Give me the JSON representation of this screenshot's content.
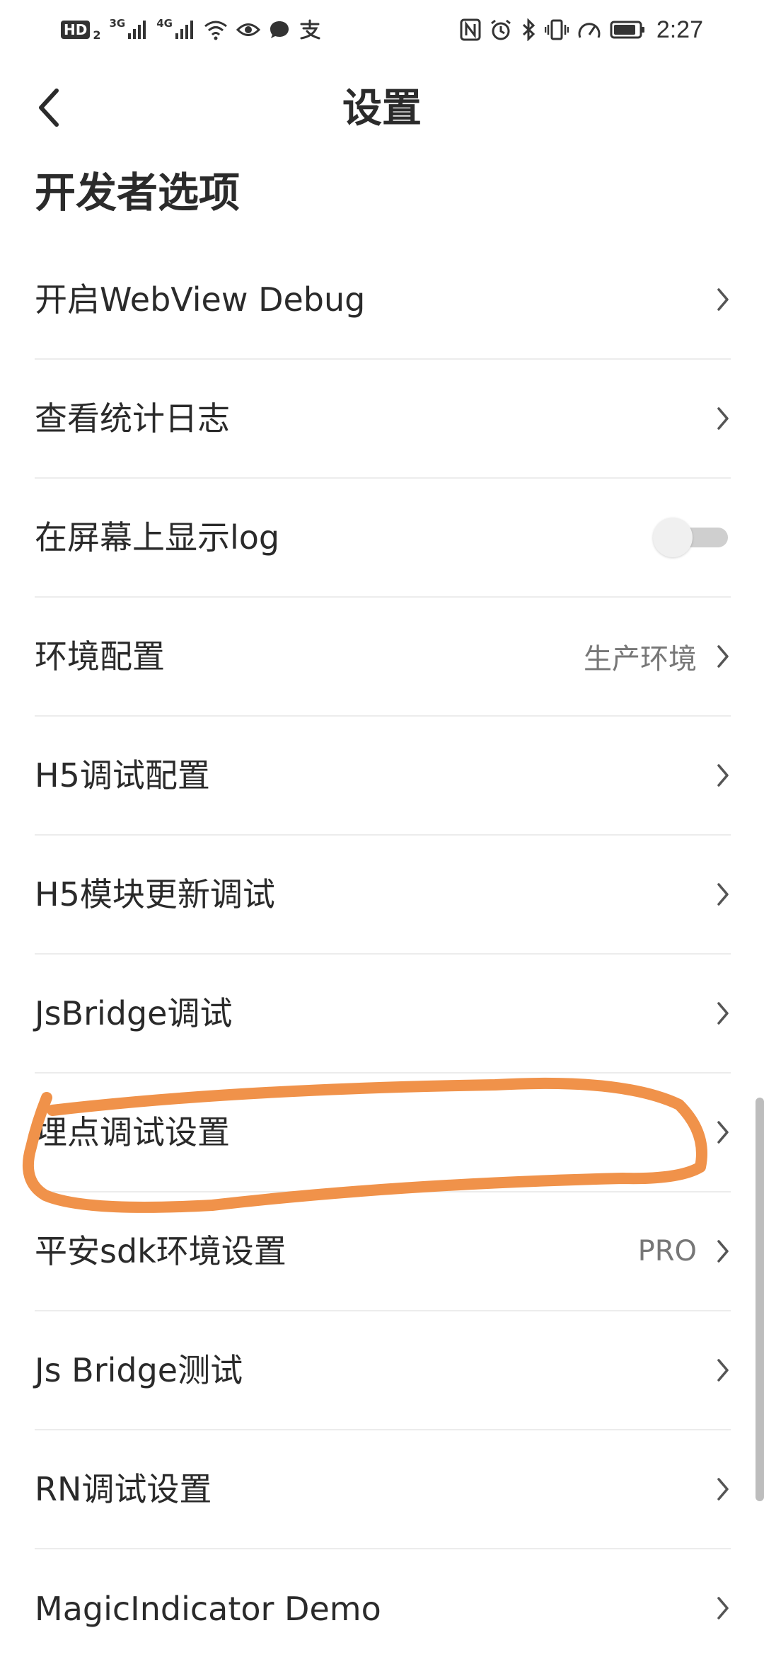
{
  "status_bar": {
    "hd_badge": "HD",
    "sim_index": "2",
    "net_3g": "3G",
    "net_4g": "4G",
    "time": "2:27",
    "icons": [
      "signal-icon",
      "wifi-icon",
      "eye-icon",
      "message-icon",
      "alipay-icon",
      "nfc-icon",
      "alarm-icon",
      "bluetooth-icon",
      "vibrate-icon",
      "speed-icon",
      "battery-icon"
    ]
  },
  "nav": {
    "back_icon": "chevron-left-icon",
    "title": "设置"
  },
  "section": {
    "title": "开发者选项"
  },
  "settings": [
    {
      "label": "开启WebView Debug",
      "value": "",
      "control": "chevron"
    },
    {
      "label": "查看统计日志",
      "value": "",
      "control": "chevron"
    },
    {
      "label": "在屏幕上显示log",
      "value": "",
      "control": "toggle",
      "toggle_on": false
    },
    {
      "label": "环境配置",
      "value": "生产环境",
      "control": "chevron"
    },
    {
      "label": "H5调试配置",
      "value": "",
      "control": "chevron"
    },
    {
      "label": "H5模块更新调试",
      "value": "",
      "control": "chevron"
    },
    {
      "label": "JsBridge调试",
      "value": "",
      "control": "chevron"
    },
    {
      "label": "埋点调试设置",
      "value": "",
      "control": "chevron"
    },
    {
      "label": "平安sdk环境设置",
      "value": "PRO",
      "control": "chevron"
    },
    {
      "label": "Js Bridge测试",
      "value": "",
      "control": "chevron"
    },
    {
      "label": "RN调试设置",
      "value": "",
      "control": "chevron"
    },
    {
      "label": "MagicIndicator Demo",
      "value": "",
      "control": "chevron"
    }
  ],
  "colors": {
    "annotation": "#f0924a",
    "divider": "#ececec",
    "toggle_track": "#cfcfcf"
  }
}
